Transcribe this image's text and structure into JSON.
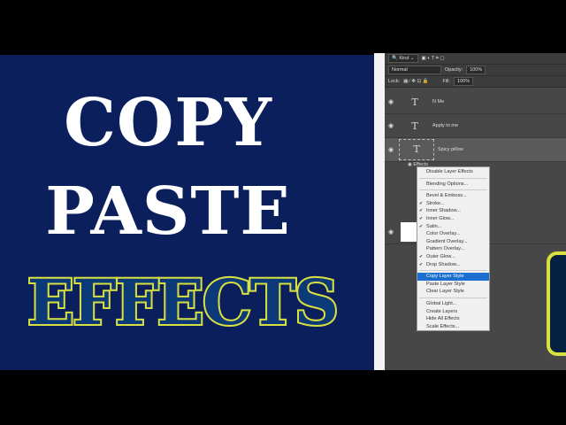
{
  "title": {
    "line1": "COPY",
    "line2": "PASTE",
    "line3": "EFFECTS"
  },
  "colors": {
    "background": "#0a1f5c",
    "effects_fill": "#0c3a78",
    "effects_stroke": "#d9e040",
    "menu_highlight": "#1a6fd0"
  },
  "layers_panel": {
    "filter": "Kind",
    "blend_mode": "Normal",
    "opacity_label": "Opacity:",
    "opacity": "100%",
    "lock_label": "Lock:",
    "fill_label": "Fill:",
    "fill": "100%",
    "layers": [
      {
        "name": "N Me",
        "type": "text"
      },
      {
        "name": "Apply to me",
        "type": "text"
      },
      {
        "name": "Spicy pillow",
        "type": "text",
        "selected": true
      }
    ],
    "effects_label": "Effects"
  },
  "context_menu": {
    "items": [
      {
        "label": "Disable Layer Effects"
      },
      {
        "sep": true
      },
      {
        "label": "Blending Options..."
      },
      {
        "sep": true
      },
      {
        "label": "Bevel & Emboss..."
      },
      {
        "label": "Stroke...",
        "checked": true
      },
      {
        "label": "Inner Shadow...",
        "checked": true
      },
      {
        "label": "Inner Glow...",
        "checked": true
      },
      {
        "label": "Satin...",
        "checked": true
      },
      {
        "label": "Color Overlay..."
      },
      {
        "label": "Gradient Overlay..."
      },
      {
        "label": "Pattern Overlay..."
      },
      {
        "label": "Outer Glow...",
        "checked": true
      },
      {
        "label": "Drop Shadow...",
        "checked": true
      },
      {
        "sep": true
      },
      {
        "label": "Copy Layer Style",
        "selected": true
      },
      {
        "label": "Paste Layer Style"
      },
      {
        "label": "Clear Layer Style"
      },
      {
        "sep": true
      },
      {
        "label": "Global Light..."
      },
      {
        "label": "Create Layers"
      },
      {
        "label": "Hide All Effects"
      },
      {
        "label": "Scale Effects..."
      }
    ]
  }
}
